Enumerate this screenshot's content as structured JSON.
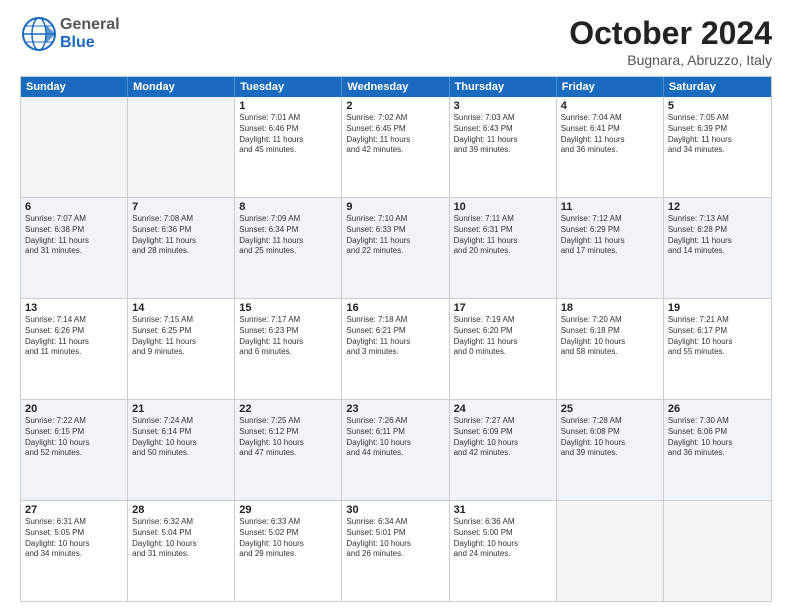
{
  "logo": {
    "line1": "General",
    "line2": "Blue"
  },
  "title": "October 2024",
  "location": "Bugnara, Abruzzo, Italy",
  "days_of_week": [
    "Sunday",
    "Monday",
    "Tuesday",
    "Wednesday",
    "Thursday",
    "Friday",
    "Saturday"
  ],
  "weeks": [
    [
      {
        "day": "",
        "info": [],
        "empty": true
      },
      {
        "day": "",
        "info": [],
        "empty": true
      },
      {
        "day": "1",
        "info": [
          "Sunrise: 7:01 AM",
          "Sunset: 6:46 PM",
          "Daylight: 11 hours",
          "and 45 minutes."
        ],
        "empty": false
      },
      {
        "day": "2",
        "info": [
          "Sunrise: 7:02 AM",
          "Sunset: 6:45 PM",
          "Daylight: 11 hours",
          "and 42 minutes."
        ],
        "empty": false
      },
      {
        "day": "3",
        "info": [
          "Sunrise: 7:03 AM",
          "Sunset: 6:43 PM",
          "Daylight: 11 hours",
          "and 39 minutes."
        ],
        "empty": false
      },
      {
        "day": "4",
        "info": [
          "Sunrise: 7:04 AM",
          "Sunset: 6:41 PM",
          "Daylight: 11 hours",
          "and 36 minutes."
        ],
        "empty": false
      },
      {
        "day": "5",
        "info": [
          "Sunrise: 7:05 AM",
          "Sunset: 6:39 PM",
          "Daylight: 11 hours",
          "and 34 minutes."
        ],
        "empty": false
      }
    ],
    [
      {
        "day": "6",
        "info": [
          "Sunrise: 7:07 AM",
          "Sunset: 6:38 PM",
          "Daylight: 11 hours",
          "and 31 minutes."
        ],
        "empty": false
      },
      {
        "day": "7",
        "info": [
          "Sunrise: 7:08 AM",
          "Sunset: 6:36 PM",
          "Daylight: 11 hours",
          "and 28 minutes."
        ],
        "empty": false
      },
      {
        "day": "8",
        "info": [
          "Sunrise: 7:09 AM",
          "Sunset: 6:34 PM",
          "Daylight: 11 hours",
          "and 25 minutes."
        ],
        "empty": false
      },
      {
        "day": "9",
        "info": [
          "Sunrise: 7:10 AM",
          "Sunset: 6:33 PM",
          "Daylight: 11 hours",
          "and 22 minutes."
        ],
        "empty": false
      },
      {
        "day": "10",
        "info": [
          "Sunrise: 7:11 AM",
          "Sunset: 6:31 PM",
          "Daylight: 11 hours",
          "and 20 minutes."
        ],
        "empty": false
      },
      {
        "day": "11",
        "info": [
          "Sunrise: 7:12 AM",
          "Sunset: 6:29 PM",
          "Daylight: 11 hours",
          "and 17 minutes."
        ],
        "empty": false
      },
      {
        "day": "12",
        "info": [
          "Sunrise: 7:13 AM",
          "Sunset: 6:28 PM",
          "Daylight: 11 hours",
          "and 14 minutes."
        ],
        "empty": false
      }
    ],
    [
      {
        "day": "13",
        "info": [
          "Sunrise: 7:14 AM",
          "Sunset: 6:26 PM",
          "Daylight: 11 hours",
          "and 11 minutes."
        ],
        "empty": false
      },
      {
        "day": "14",
        "info": [
          "Sunrise: 7:15 AM",
          "Sunset: 6:25 PM",
          "Daylight: 11 hours",
          "and 9 minutes."
        ],
        "empty": false
      },
      {
        "day": "15",
        "info": [
          "Sunrise: 7:17 AM",
          "Sunset: 6:23 PM",
          "Daylight: 11 hours",
          "and 6 minutes."
        ],
        "empty": false
      },
      {
        "day": "16",
        "info": [
          "Sunrise: 7:18 AM",
          "Sunset: 6:21 PM",
          "Daylight: 11 hours",
          "and 3 minutes."
        ],
        "empty": false
      },
      {
        "day": "17",
        "info": [
          "Sunrise: 7:19 AM",
          "Sunset: 6:20 PM",
          "Daylight: 11 hours",
          "and 0 minutes."
        ],
        "empty": false
      },
      {
        "day": "18",
        "info": [
          "Sunrise: 7:20 AM",
          "Sunset: 6:18 PM",
          "Daylight: 10 hours",
          "and 58 minutes."
        ],
        "empty": false
      },
      {
        "day": "19",
        "info": [
          "Sunrise: 7:21 AM",
          "Sunset: 6:17 PM",
          "Daylight: 10 hours",
          "and 55 minutes."
        ],
        "empty": false
      }
    ],
    [
      {
        "day": "20",
        "info": [
          "Sunrise: 7:22 AM",
          "Sunset: 6:15 PM",
          "Daylight: 10 hours",
          "and 52 minutes."
        ],
        "empty": false
      },
      {
        "day": "21",
        "info": [
          "Sunrise: 7:24 AM",
          "Sunset: 6:14 PM",
          "Daylight: 10 hours",
          "and 50 minutes."
        ],
        "empty": false
      },
      {
        "day": "22",
        "info": [
          "Sunrise: 7:25 AM",
          "Sunset: 6:12 PM",
          "Daylight: 10 hours",
          "and 47 minutes."
        ],
        "empty": false
      },
      {
        "day": "23",
        "info": [
          "Sunrise: 7:26 AM",
          "Sunset: 6:11 PM",
          "Daylight: 10 hours",
          "and 44 minutes."
        ],
        "empty": false
      },
      {
        "day": "24",
        "info": [
          "Sunrise: 7:27 AM",
          "Sunset: 6:09 PM",
          "Daylight: 10 hours",
          "and 42 minutes."
        ],
        "empty": false
      },
      {
        "day": "25",
        "info": [
          "Sunrise: 7:28 AM",
          "Sunset: 6:08 PM",
          "Daylight: 10 hours",
          "and 39 minutes."
        ],
        "empty": false
      },
      {
        "day": "26",
        "info": [
          "Sunrise: 7:30 AM",
          "Sunset: 6:06 PM",
          "Daylight: 10 hours",
          "and 36 minutes."
        ],
        "empty": false
      }
    ],
    [
      {
        "day": "27",
        "info": [
          "Sunrise: 6:31 AM",
          "Sunset: 5:05 PM",
          "Daylight: 10 hours",
          "and 34 minutes."
        ],
        "empty": false
      },
      {
        "day": "28",
        "info": [
          "Sunrise: 6:32 AM",
          "Sunset: 5:04 PM",
          "Daylight: 10 hours",
          "and 31 minutes."
        ],
        "empty": false
      },
      {
        "day": "29",
        "info": [
          "Sunrise: 6:33 AM",
          "Sunset: 5:02 PM",
          "Daylight: 10 hours",
          "and 29 minutes."
        ],
        "empty": false
      },
      {
        "day": "30",
        "info": [
          "Sunrise: 6:34 AM",
          "Sunset: 5:01 PM",
          "Daylight: 10 hours",
          "and 26 minutes."
        ],
        "empty": false
      },
      {
        "day": "31",
        "info": [
          "Sunrise: 6:36 AM",
          "Sunset: 5:00 PM",
          "Daylight: 10 hours",
          "and 24 minutes."
        ],
        "empty": false
      },
      {
        "day": "",
        "info": [],
        "empty": true
      },
      {
        "day": "",
        "info": [],
        "empty": true
      }
    ]
  ]
}
